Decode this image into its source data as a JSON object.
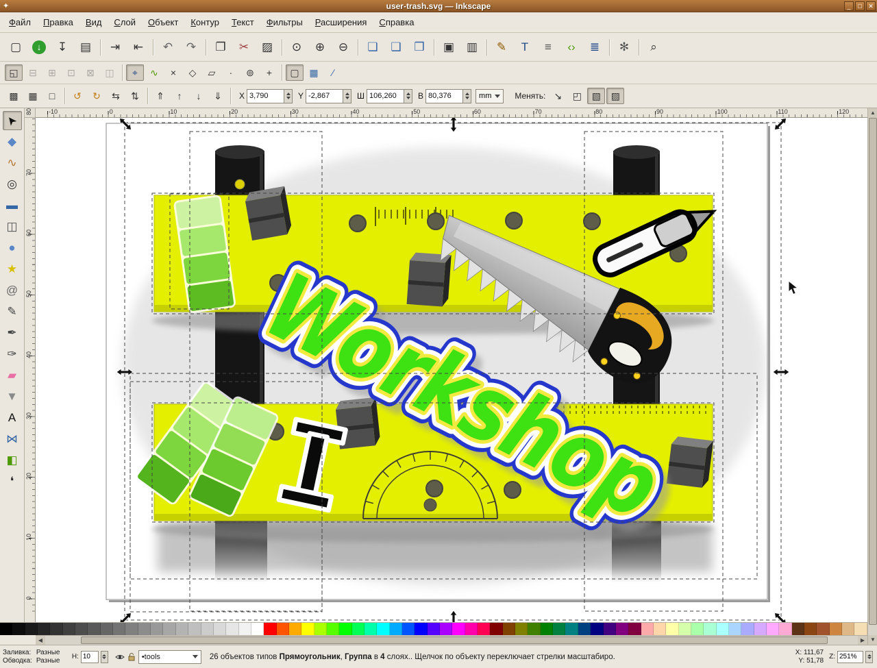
{
  "window": {
    "title": "user-trash.svg — Inkscape",
    "icon_glyph": "✦",
    "controls": [
      {
        "name": "minimize-button",
        "glyph": "_"
      },
      {
        "name": "maximize-button",
        "glyph": "□"
      },
      {
        "name": "close-button",
        "glyph": "✕"
      }
    ]
  },
  "menubar": {
    "items": [
      "Файл",
      "Правка",
      "Вид",
      "Слой",
      "Объект",
      "Контур",
      "Текст",
      "Фильтры",
      "Расширения",
      "Справка"
    ]
  },
  "command_toolbar": {
    "buttons": [
      {
        "name": "new-document",
        "glyph": "▢"
      },
      {
        "name": "open-document",
        "glyph": "↓",
        "circle": true,
        "bg": "#2f9e2f",
        "color": "#ffffff"
      },
      {
        "name": "save-document",
        "glyph": "↧"
      },
      {
        "name": "print-document",
        "glyph": "▤"
      },
      "|",
      {
        "name": "import-bitmap",
        "glyph": "⇥"
      },
      {
        "name": "export-bitmap",
        "glyph": "⇤"
      },
      "|",
      {
        "name": "undo",
        "glyph": "↶",
        "color": "#666666"
      },
      {
        "name": "redo",
        "glyph": "↷",
        "color": "#666666"
      },
      "|",
      {
        "name": "copy",
        "glyph": "❐"
      },
      {
        "name": "cut",
        "glyph": "✂",
        "color": "#a04040"
      },
      {
        "name": "paste",
        "glyph": "▨"
      },
      "|",
      {
        "name": "zoom-to-selection",
        "glyph": "⊙"
      },
      {
        "name": "zoom-to-drawing",
        "glyph": "⊕"
      },
      {
        "name": "zoom-to-page",
        "glyph": "⊖"
      },
      "|",
      {
        "name": "duplicate",
        "glyph": "❏",
        "color": "#3465a4"
      },
      {
        "name": "create-clone",
        "glyph": "❑",
        "color": "#3465a4"
      },
      {
        "name": "unlink-clone",
        "glyph": "❒",
        "color": "#3465a4"
      },
      "|",
      {
        "name": "group-objects",
        "glyph": "▣"
      },
      {
        "name": "ungroup-objects",
        "glyph": "▥"
      },
      "|",
      {
        "name": "fill-stroke-dialog",
        "glyph": "✎",
        "color": "#8f5902"
      },
      {
        "name": "text-dialog",
        "glyph": "T",
        "color": "#204a87"
      },
      {
        "name": "layers-dialog",
        "glyph": "≡",
        "color": "#555555"
      },
      {
        "name": "xml-editor",
        "glyph": "‹›",
        "color": "#4e9a06"
      },
      {
        "name": "align-distribute-dialog",
        "glyph": "≣",
        "color": "#204a87"
      },
      "|",
      {
        "name": "preferences",
        "glyph": "✻",
        "color": "#555555"
      },
      "|",
      {
        "name": "find",
        "glyph": "⌕",
        "color": "#333333"
      }
    ]
  },
  "snap_toolbar": {
    "buttons": [
      {
        "name": "snap-bounding-box",
        "glyph": "◱",
        "state": "active"
      },
      {
        "name": "snap-bbox-edges",
        "glyph": "⊟",
        "state": "disabled"
      },
      {
        "name": "snap-bbox-corners",
        "glyph": "⊞",
        "state": "disabled"
      },
      {
        "name": "snap-bbox-edge-midpoints",
        "glyph": "⊡",
        "state": "disabled"
      },
      {
        "name": "snap-bbox-centers",
        "glyph": "⊠",
        "state": "disabled"
      },
      {
        "name": "snap-bbox-midlines",
        "glyph": "◫",
        "state": "disabled"
      },
      "|",
      {
        "name": "snap-nodes",
        "glyph": "⌖",
        "state": "active",
        "color": "#204a87"
      },
      {
        "name": "snap-paths",
        "glyph": "∿",
        "color": "#4e9a06"
      },
      {
        "name": "snap-path-intersections",
        "glyph": "×"
      },
      {
        "name": "snap-cusp-nodes",
        "glyph": "◇"
      },
      {
        "name": "snap-smooth-nodes",
        "glyph": "▱"
      },
      {
        "name": "snap-line-midpoints",
        "glyph": "∙"
      },
      {
        "name": "snap-object-centers",
        "glyph": "⊚"
      },
      {
        "name": "snap-rotation-centers",
        "glyph": "+"
      },
      "|",
      {
        "name": "snap-page-border",
        "glyph": "▢",
        "state": "active"
      },
      {
        "name": "snap-grid",
        "glyph": "▦",
        "color": "#3465a4"
      },
      {
        "name": "snap-guides",
        "glyph": "∕",
        "color": "#3465a4"
      }
    ]
  },
  "tool_controls": {
    "select_buttons": [
      {
        "name": "select-all",
        "glyph": "▩"
      },
      {
        "name": "select-all-layers",
        "glyph": "▦"
      },
      {
        "name": "deselect",
        "glyph": "□"
      }
    ],
    "transform_buttons": [
      {
        "name": "rotate-90-ccw",
        "glyph": "↺",
        "color": "#c17d11"
      },
      {
        "name": "rotate-90-cw",
        "glyph": "↻",
        "color": "#c17d11"
      },
      {
        "name": "flip-horizontal",
        "glyph": "⇆"
      },
      {
        "name": "flip-vertical",
        "glyph": "⇅"
      }
    ],
    "zorder_buttons": [
      {
        "name": "raise-to-top",
        "glyph": "⇑"
      },
      {
        "name": "raise",
        "glyph": "↑"
      },
      {
        "name": "lower",
        "glyph": "↓"
      },
      {
        "name": "lower-to-bottom",
        "glyph": "⇓"
      }
    ],
    "fields": {
      "x": {
        "label": "X",
        "value": "3,790"
      },
      "y": {
        "label": "Y",
        "value": "-2,867"
      },
      "w": {
        "label": "Ш",
        "value": "106,260"
      },
      "h": {
        "label": "В",
        "value": "80,376"
      }
    },
    "units": "mm",
    "affect_label": "Менять:",
    "affect_buttons": [
      {
        "name": "transform-stroke",
        "glyph": "↘"
      },
      {
        "name": "transform-corners",
        "glyph": "◰"
      },
      {
        "name": "transform-gradients",
        "glyph": "▧",
        "state": "active"
      },
      {
        "name": "transform-patterns",
        "glyph": "▨",
        "state": "active"
      }
    ]
  },
  "toolbox": {
    "tools": [
      {
        "name": "selector-tool",
        "glyph": "➤",
        "rot": -128,
        "color": "#111111",
        "state": "active"
      },
      {
        "name": "node-tool",
        "glyph": "◆",
        "color": "#5b87c7"
      },
      {
        "name": "tweak-tool",
        "glyph": "∿",
        "color": "#b8762e"
      },
      {
        "name": "zoom-tool",
        "glyph": "◎",
        "color": "#333333"
      },
      {
        "name": "rectangle-tool",
        "glyph": "▬",
        "color": "#3465a4"
      },
      {
        "name": "box3d-tool",
        "glyph": "◫",
        "color": "#555555"
      },
      {
        "name": "ellipse-tool",
        "glyph": "●",
        "color": "#5b87c7"
      },
      {
        "name": "star-tool",
        "glyph": "★",
        "color": "#d8c000"
      },
      {
        "name": "spiral-tool",
        "glyph": "@",
        "color": "#666666"
      },
      {
        "name": "pencil-tool",
        "glyph": "✎",
        "color": "#444444"
      },
      {
        "name": "pen-tool",
        "glyph": "✒",
        "color": "#444444"
      },
      {
        "name": "calligraphy-tool",
        "glyph": "✑",
        "color": "#444444"
      },
      {
        "name": "eraser-tool",
        "glyph": "▰",
        "color": "#e86ea4"
      },
      {
        "name": "paint-bucket-tool",
        "glyph": "▼",
        "color": "#8a8a8a"
      },
      {
        "name": "text-tool",
        "glyph": "A",
        "color": "#111111"
      },
      {
        "name": "connector-tool",
        "glyph": "⋈",
        "color": "#3465a4"
      },
      {
        "name": "gradient-tool",
        "glyph": "◧",
        "color": "#4e9a06"
      },
      {
        "name": "dropper-tool",
        "glyph": "❛",
        "color": "#222222"
      }
    ]
  },
  "rulers": {
    "horizontal_labels": [
      "-10",
      "0",
      "10",
      "20",
      "30",
      "40",
      "50",
      "60",
      "70",
      "80",
      "90",
      "100",
      "110",
      "120"
    ],
    "vertical_labels": [
      "80",
      "70",
      "60",
      "50",
      "40",
      "30",
      "20",
      "10",
      "0"
    ]
  },
  "canvas": {
    "sticker_text": "Workshop"
  },
  "palette": {
    "colors": [
      "#000000",
      "#0d0d0d",
      "#1a1a1a",
      "#262626",
      "#333333",
      "#404040",
      "#4d4d4d",
      "#595959",
      "#666666",
      "#737373",
      "#808080",
      "#8c8c8c",
      "#999999",
      "#a6a6a6",
      "#b3b3b3",
      "#bfbfbf",
      "#cccccc",
      "#d9d9d9",
      "#e6e6e6",
      "#f2f2f2",
      "#ffffff",
      "#ff0000",
      "#ff5500",
      "#ffaa00",
      "#ffff00",
      "#aaff00",
      "#55ff00",
      "#00ff00",
      "#00ff55",
      "#00ffaa",
      "#00ffff",
      "#00aaff",
      "#0055ff",
      "#0000ff",
      "#5500ff",
      "#aa00ff",
      "#ff00ff",
      "#ff00aa",
      "#ff0055",
      "#800000",
      "#804000",
      "#808000",
      "#408000",
      "#008000",
      "#008040",
      "#008080",
      "#004080",
      "#000080",
      "#400080",
      "#800080",
      "#800040",
      "#ffaaaa",
      "#ffd5aa",
      "#ffffaa",
      "#d5ffaa",
      "#aaffaa",
      "#aaffd5",
      "#aaffff",
      "#aad5ff",
      "#aaaaff",
      "#d5aaff",
      "#ffaaff",
      "#ffaad5",
      "#5c3317",
      "#8b4513",
      "#a0522d",
      "#cd853f",
      "#deb887",
      "#f5deb3"
    ]
  },
  "statusbar": {
    "fill_label": "Заливка:",
    "fill_value": "Разные",
    "stroke_label": "Обводка:",
    "stroke_value": "Разные",
    "opacity_label": "Н:",
    "opacity_value": "10",
    "layer_name": "•tools",
    "message": {
      "p1": "26 объектов типов ",
      "b1": "Прямоугольник",
      "p2": ", ",
      "b2": "Группа",
      "p3": " в ",
      "b3": "4",
      "p4": " слоях.. Щелчок по объекту переключает стрелки масштабиро."
    },
    "x_label": "X:",
    "x_value": "111,67",
    "y_label": "Y:",
    "y_value": "51,78",
    "z_label": "Z:",
    "zoom_value": "251%"
  }
}
